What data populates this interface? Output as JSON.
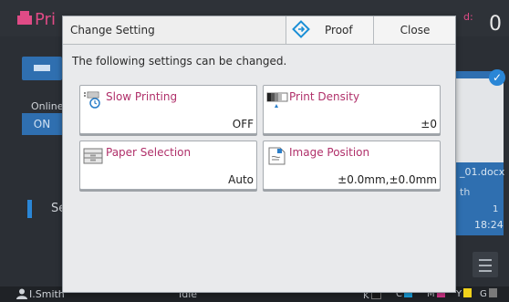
{
  "background": {
    "app_title": "Pri",
    "counter_label": "d:",
    "counter_value": "0",
    "online_label": "Online",
    "on_label": "ON",
    "left_button_label": "Se",
    "job_name": "_01.docx",
    "job_subtext": "th",
    "job_copies": "1",
    "job_time": "18:24"
  },
  "status_bar": {
    "user": "I.Smith",
    "status": "Idle",
    "inks": [
      {
        "label": "K",
        "color": "#1a1a1a"
      },
      {
        "label": "C",
        "color": "#1aa3e0"
      },
      {
        "label": "M",
        "color": "#d9388f"
      },
      {
        "label": "Y",
        "color": "#f1d21b"
      },
      {
        "label": "G",
        "color": "#7a7a7a"
      }
    ]
  },
  "dialog": {
    "title": "Change Setting",
    "proof_label": "Proof",
    "close_label": "Close",
    "subtitle": "The following settings can be changed.",
    "settings": [
      {
        "name": "Slow Printing",
        "value": "OFF",
        "icon": "slow-printing-icon"
      },
      {
        "name": "Print Density",
        "value": "±0",
        "icon": "print-density-icon"
      },
      {
        "name": "Paper Selection",
        "value": "Auto",
        "icon": "paper-tray-icon"
      },
      {
        "name": "Image Position",
        "value": "±0.0mm,±0.0mm",
        "icon": "image-position-icon"
      }
    ]
  },
  "colors": {
    "accent_pink": "#b0306a",
    "accent_blue": "#2f6fb0"
  }
}
